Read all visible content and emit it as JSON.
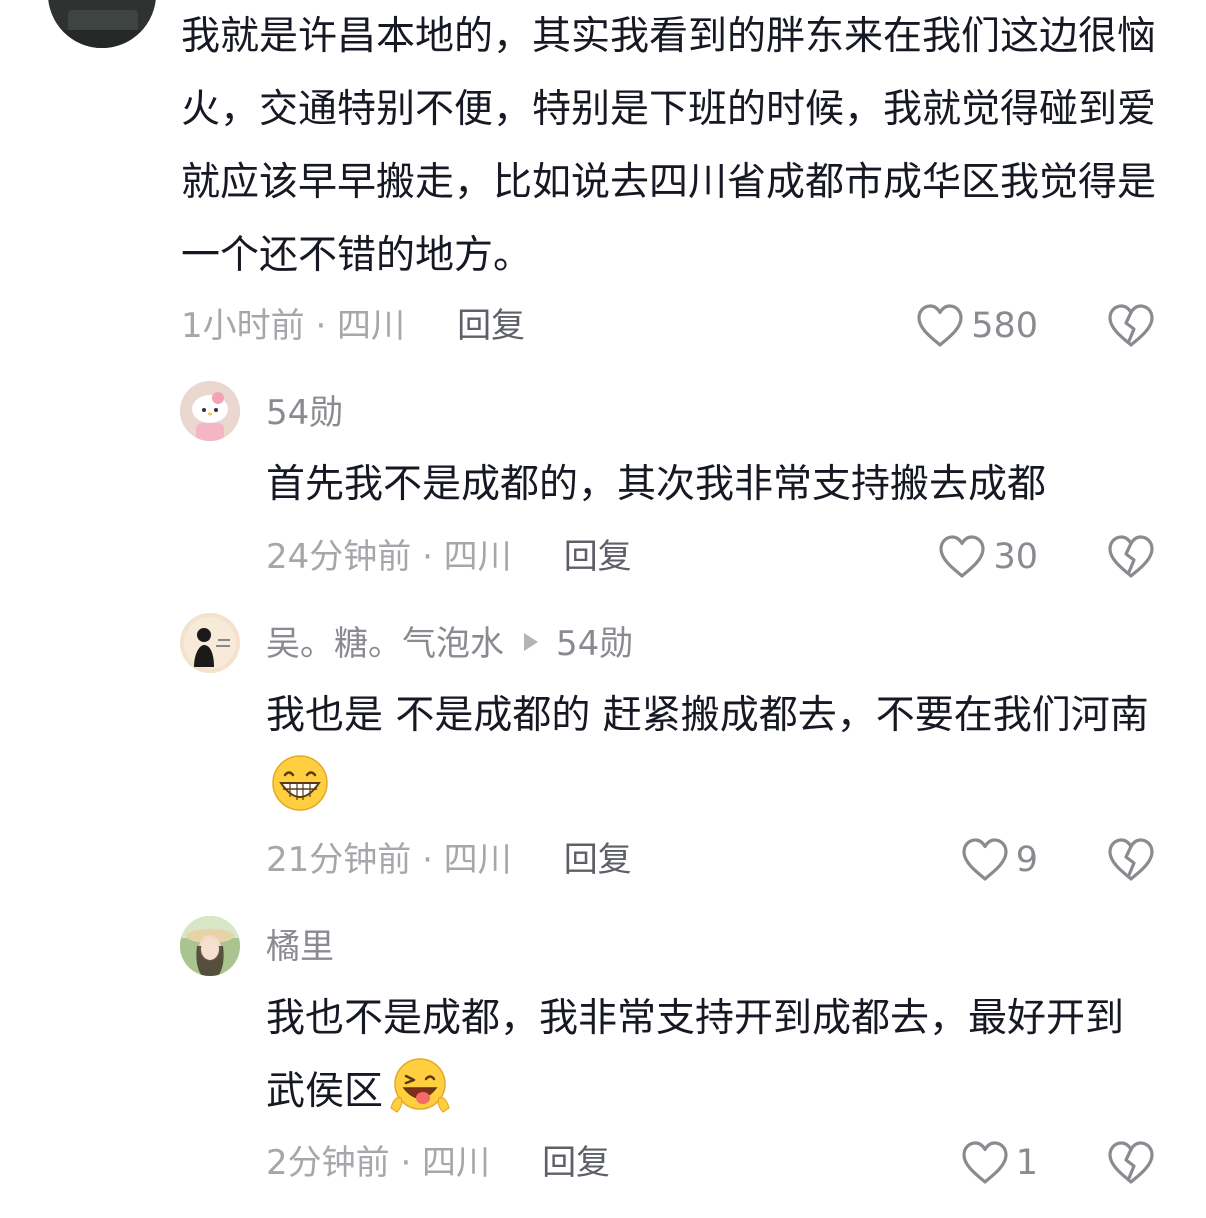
{
  "comments": [
    {
      "text": "我就是许昌本地的，其实我看到的胖东来在我们这边很恼火，交通特别不便，特别是下班的时候，我就觉得碰到爱就应该早早搬走，比如说去四川省成都市成华区我觉得是一个还不错的地方。",
      "time_location": "1小时前 · 四川",
      "reply_label": "回复",
      "likes": "580"
    },
    {
      "username": "54勋",
      "text": "首先我不是成都的，其次我非常支持搬去成都",
      "time_location": "24分钟前 · 四川",
      "reply_label": "回复",
      "likes": "30"
    },
    {
      "username": "吴。糖。气泡水",
      "reply_to": "54勋",
      "text": "我也是  不是成都的 赶紧搬成都去，不要在我们河南",
      "emoji": "grinning-face-emoji",
      "time_location": "21分钟前 · 四川",
      "reply_label": "回复",
      "likes": "9"
    },
    {
      "username": "橘里",
      "text": "我也不是成都，我非常支持开到成都去，最好开到武侯区",
      "emoji": "winking-tongue-face-emoji",
      "time_location": "2分钟前 · 四川",
      "reply_label": "回复",
      "likes": "1"
    }
  ],
  "icons": {
    "like": "heart-outline-icon",
    "dislike": "broken-heart-icon"
  },
  "colors": {
    "text": "#161823",
    "secondary": "#8a8b91",
    "time": "#a6a7ab",
    "reply": "#5e6068",
    "icon": "#8a8b91"
  }
}
